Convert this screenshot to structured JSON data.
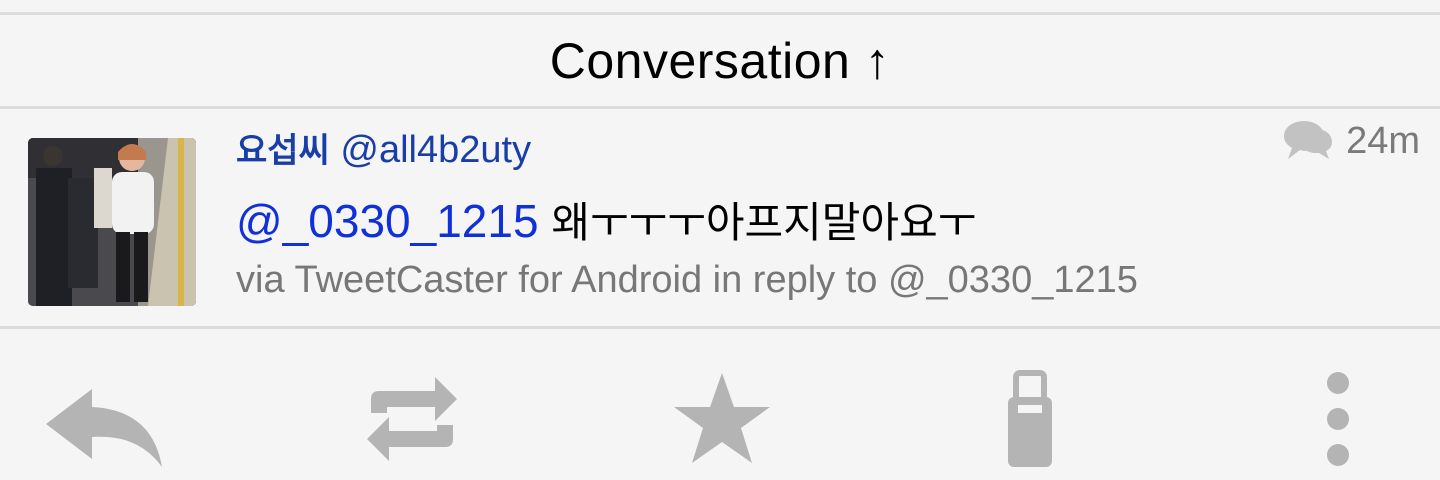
{
  "header": {
    "title": "Conversation ↑"
  },
  "tweet": {
    "display_name": "요섭씨",
    "handle": "@all4b2uty",
    "time": "24m",
    "mention": "@_0330_1215",
    "text": "왜ㅜㅜㅜ아프지말아요ㅜ",
    "meta": "via TweetCaster for Android in reply to @_0330_1215"
  },
  "actions": {
    "reply_icon": "reply-icon",
    "retweet_icon": "retweet-icon",
    "favorite_icon": "star-icon",
    "clipboard_icon": "clipboard-icon",
    "more_icon": "overflow-menu-icon"
  },
  "colors": {
    "background": "#f5f5f5",
    "name_blue": "#1a3ea8",
    "mention_blue": "#1030d8",
    "meta_gray": "#777777",
    "icon_gray": "#b4b4b4",
    "divider": "#dcdcdc"
  }
}
